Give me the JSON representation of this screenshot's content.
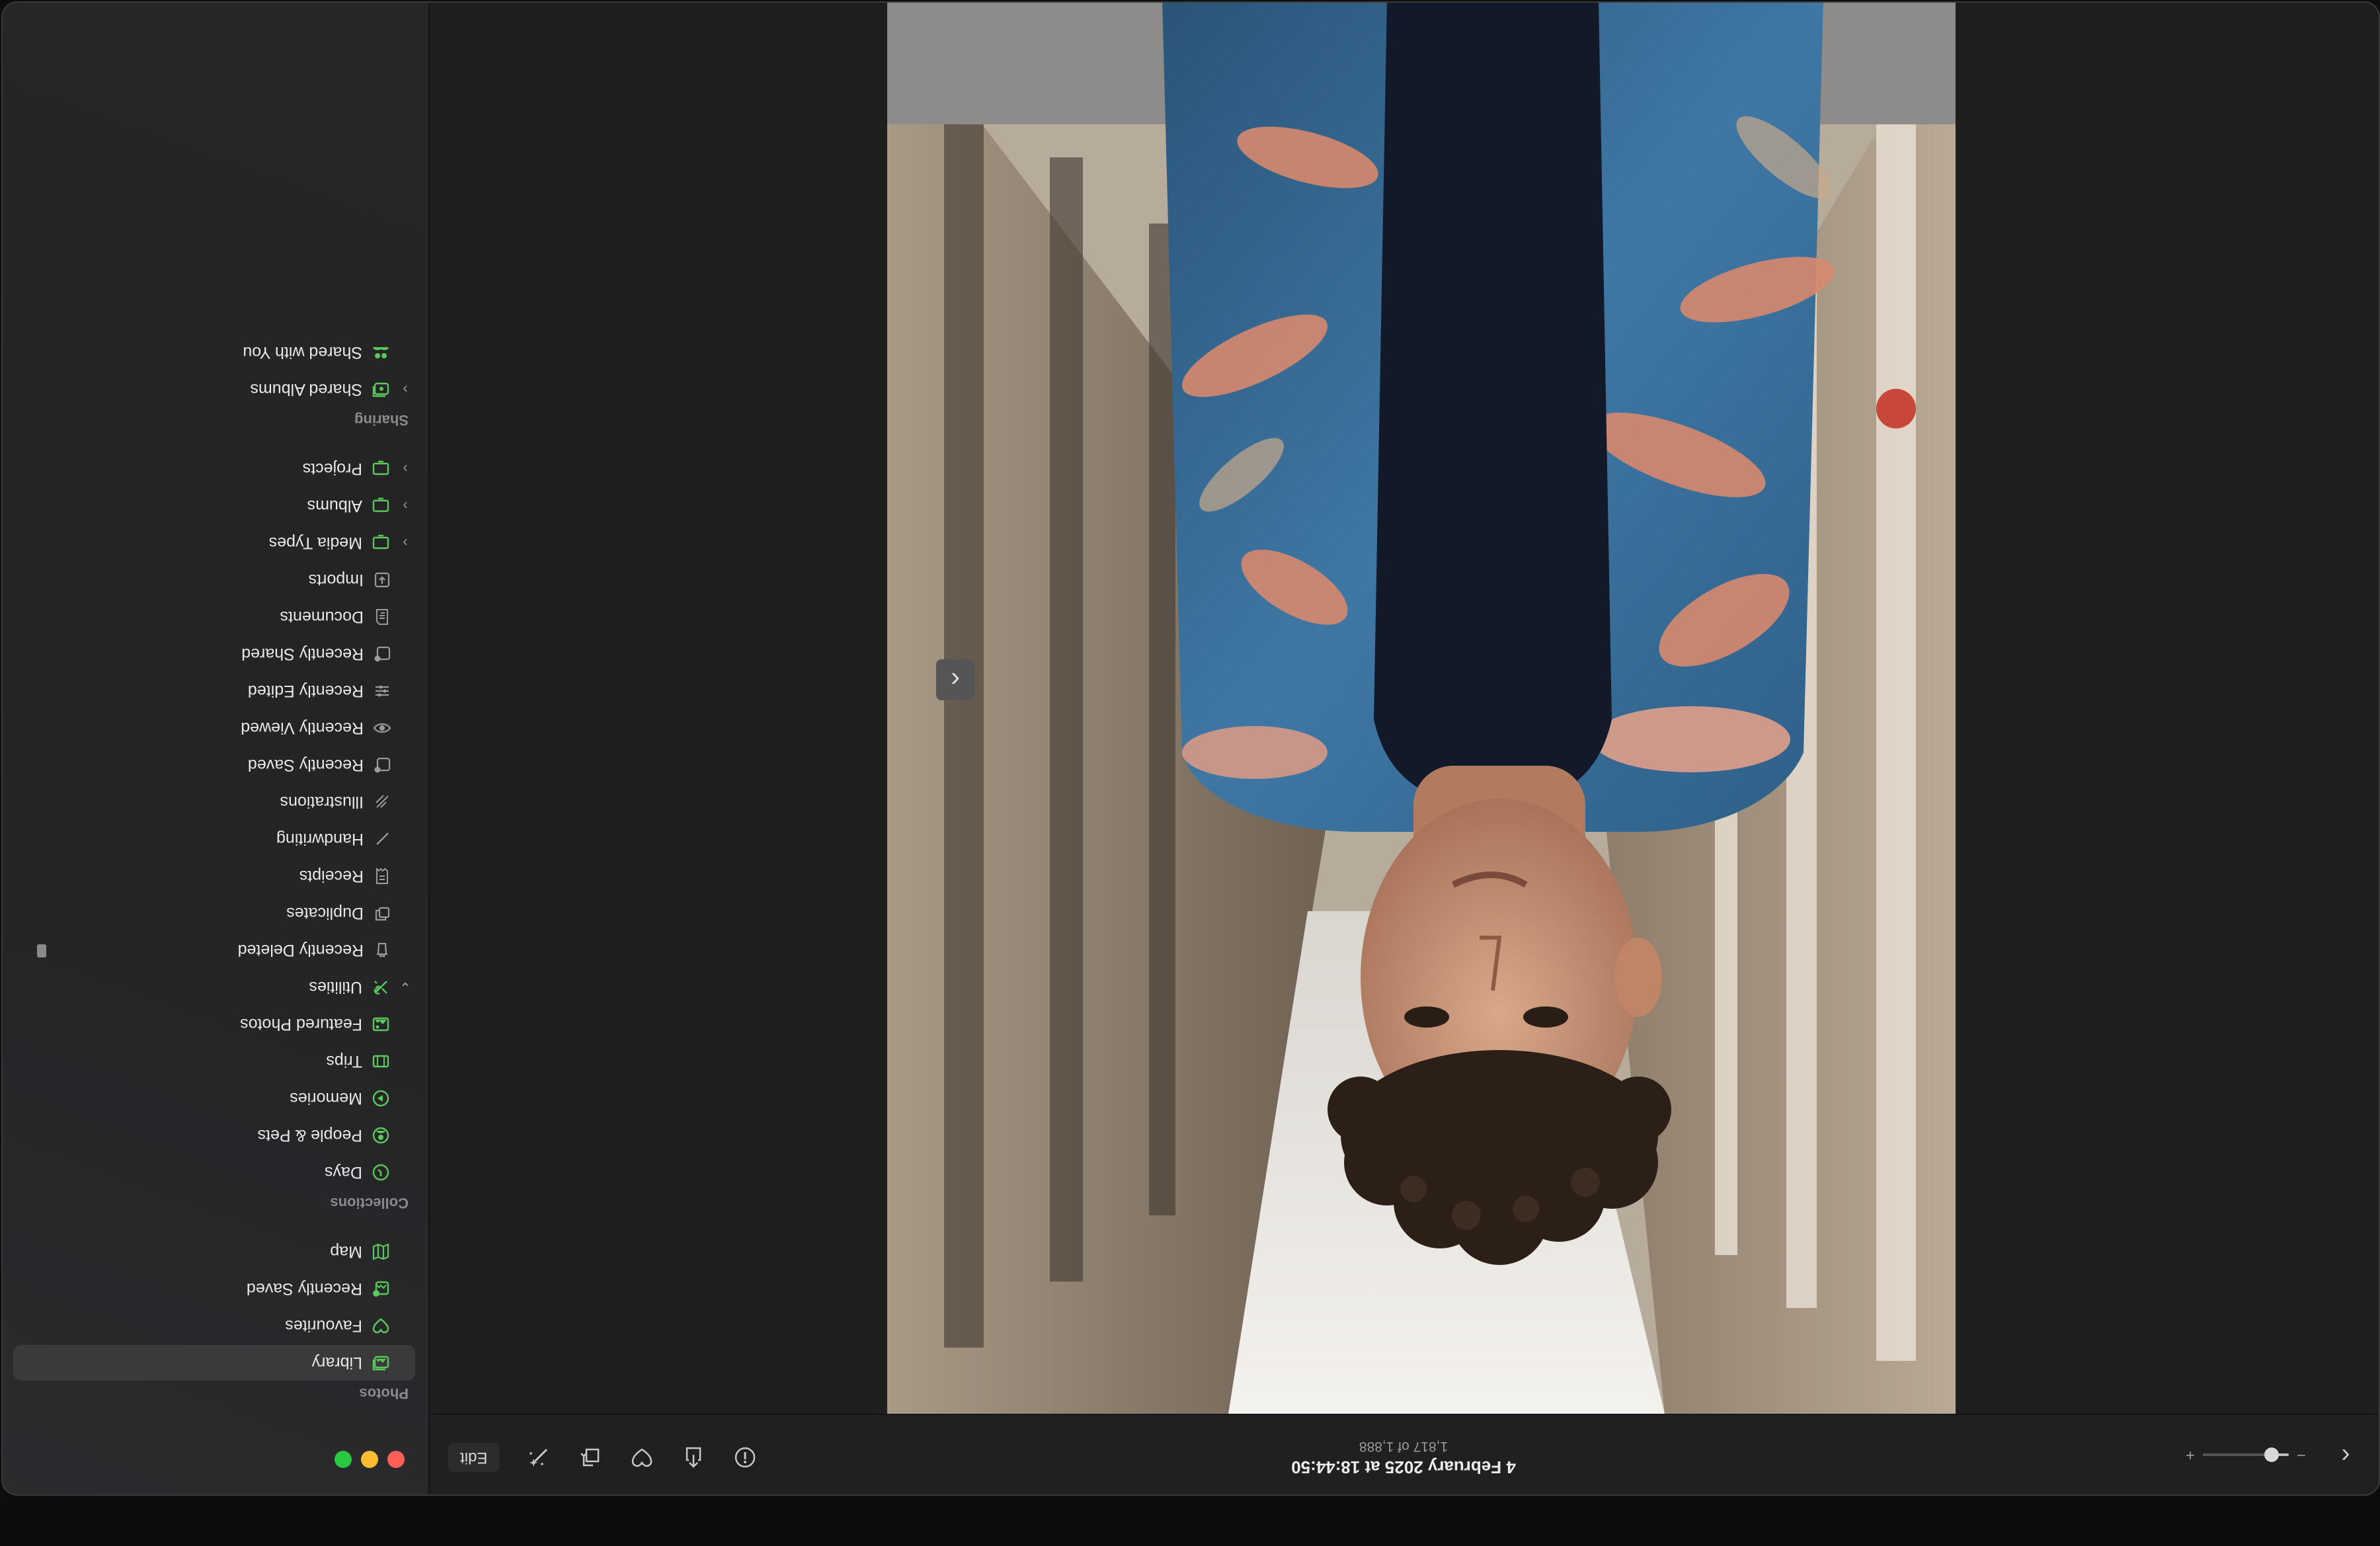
{
  "window": {
    "title": "Photos"
  },
  "sidebar": {
    "photos_section": {
      "heading": "Photos",
      "items": [
        {
          "label": "Library",
          "icon": "library-icon",
          "selected": true
        },
        {
          "label": "Favourites",
          "icon": "heart-icon"
        },
        {
          "label": "Recently Saved",
          "icon": "recently-saved-icon"
        },
        {
          "label": "Map",
          "icon": "map-icon"
        }
      ]
    },
    "collections_section": {
      "heading": "Collections",
      "items": [
        {
          "label": "Days",
          "icon": "days-icon"
        },
        {
          "label": "People & Pets",
          "icon": "people-icon"
        },
        {
          "label": "Memories",
          "icon": "memories-icon"
        },
        {
          "label": "Trips",
          "icon": "trips-icon"
        },
        {
          "label": "Featured Photos",
          "icon": "featured-photos-icon"
        }
      ]
    },
    "utilities": {
      "label": "Utilities",
      "icon": "utilities-icon",
      "expanded": true,
      "items": [
        {
          "label": "Recently Deleted",
          "icon": "trash-icon",
          "locked": true
        },
        {
          "label": "Duplicates",
          "icon": "duplicates-icon"
        },
        {
          "label": "Receipts",
          "icon": "receipts-icon"
        },
        {
          "label": "Handwriting",
          "icon": "handwriting-icon"
        },
        {
          "label": "Illustrations",
          "icon": "illustrations-icon"
        },
        {
          "label": "Recently Saved",
          "icon": "recently-saved-icon"
        },
        {
          "label": "Recently Viewed",
          "icon": "eye-icon"
        },
        {
          "label": "Recently Edited",
          "icon": "edited-icon"
        },
        {
          "label": "Recently Shared",
          "icon": "shared-icon"
        },
        {
          "label": "Documents",
          "icon": "documents-icon"
        },
        {
          "label": "Imports",
          "icon": "imports-icon"
        }
      ]
    },
    "groups": [
      {
        "label": "Media Types",
        "icon": "folder-icon"
      },
      {
        "label": "Albums",
        "icon": "folder-icon"
      },
      {
        "label": "Projects",
        "icon": "folder-icon"
      }
    ],
    "sharing_section": {
      "heading": "Sharing",
      "items": [
        {
          "label": "Shared Albums",
          "icon": "shared-albums-icon",
          "collapsible": true
        },
        {
          "label": "Shared with You",
          "icon": "shared-with-you-icon"
        }
      ]
    },
    "accent_color": "#5ac85a"
  },
  "toolbar": {
    "date": "4 February 2025 at 18:44:50",
    "position": "1,817 of 1,888",
    "zoom_level": 0.2,
    "zoom_minus": "−",
    "zoom_plus": "+",
    "edit_label": "Edit",
    "icons": [
      "info-icon",
      "share-icon",
      "heart-icon",
      "rotate-icon",
      "enhance-icon"
    ]
  },
  "photo": {
    "subject": "young man with curly hair wearing a blue floral embroidered jacket in a corridor",
    "orientation": "upside-down"
  }
}
